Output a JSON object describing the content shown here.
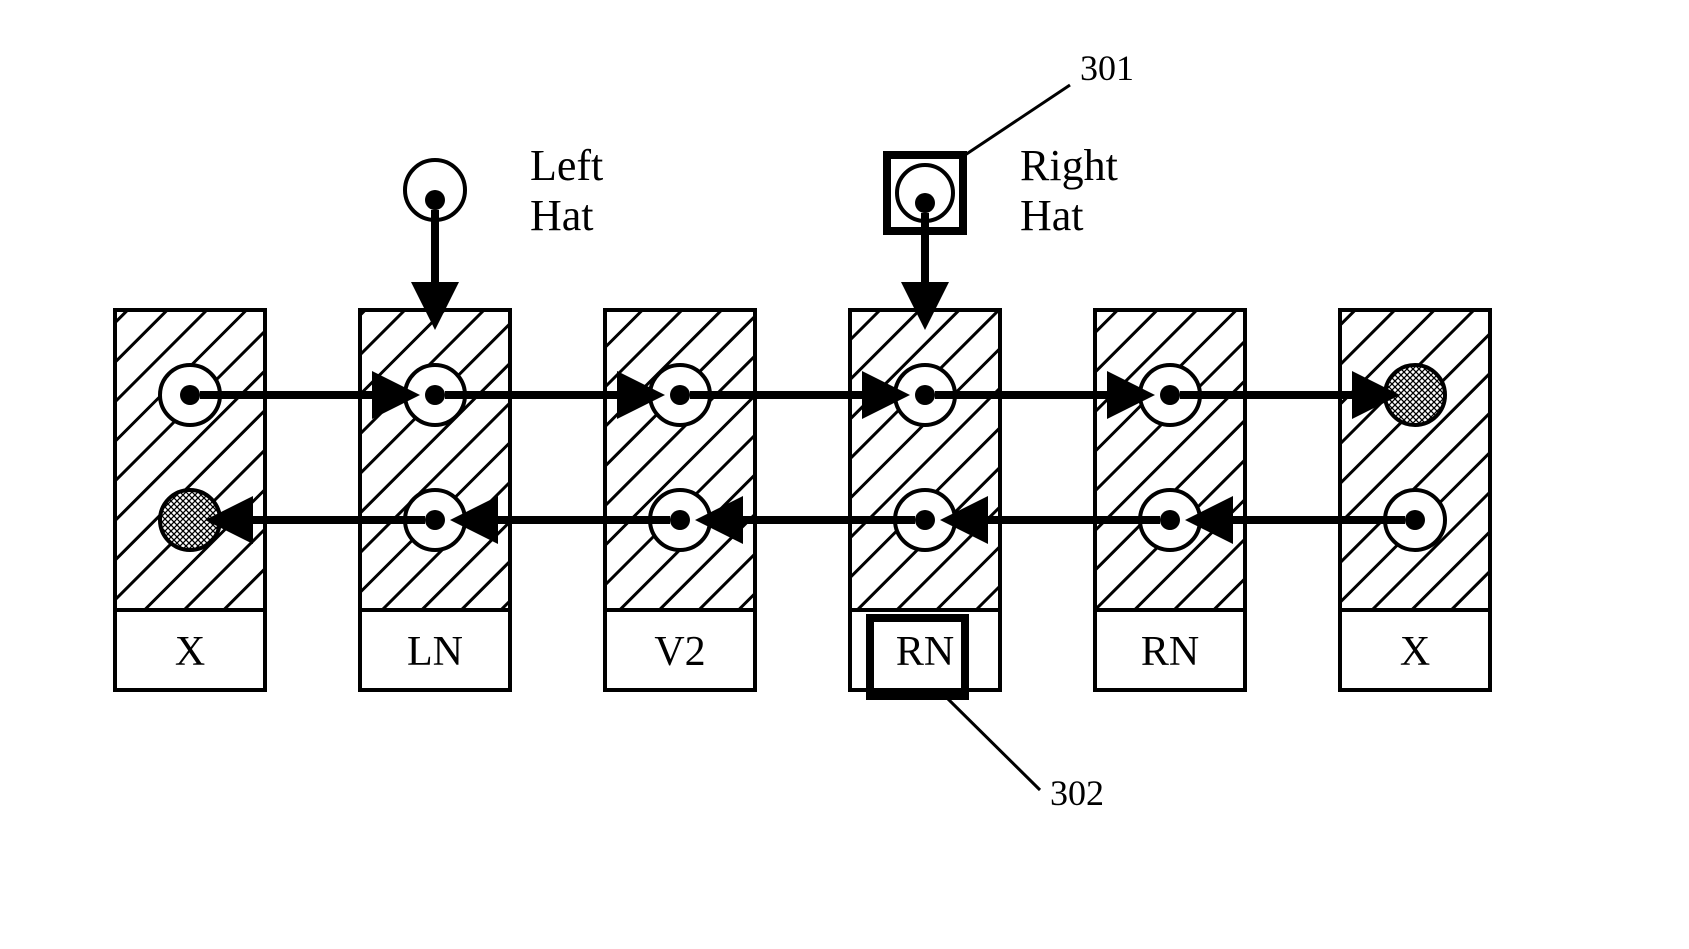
{
  "labels": {
    "left_hat_line1": "Left",
    "left_hat_line2": "Hat",
    "right_hat_line1": "Right",
    "right_hat_line2": "Hat"
  },
  "callouts": {
    "top": "301",
    "bottom": "302"
  },
  "boxes": {
    "b0": "X",
    "b1": "LN",
    "b2": "V2",
    "b3": "RN",
    "b4": "RN",
    "b5": "X"
  }
}
